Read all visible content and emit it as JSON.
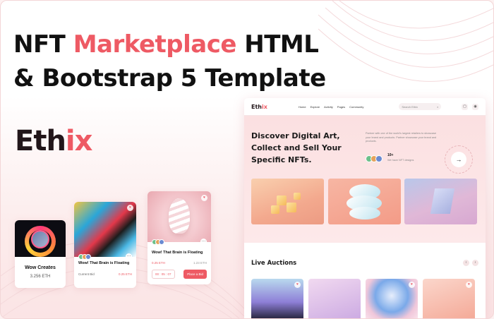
{
  "headline": {
    "line1_part1": "NFT ",
    "line1_accent": "Marketplace",
    "line1_part2": " HTML",
    "line2": "& Bootstrap 5 Template"
  },
  "brand": {
    "logo_main": "Eth",
    "logo_accent": "ix"
  },
  "cards": [
    {
      "title": "Wow Creates",
      "price": "3.256 ETH"
    },
    {
      "title": "Wow! That Brain is Floating",
      "label": "Current Bid",
      "price": "0.25 ETH"
    },
    {
      "title": "Wow! That Brain is Floating",
      "price": "0.25 ETH",
      "meta": "1.23 ETH",
      "timer": "00 : 05 : 07",
      "action": "Place a Bid"
    }
  ],
  "preview": {
    "logo_main": "Eth",
    "logo_accent": "ix",
    "menu": [
      "Home",
      "Explore",
      "Activity",
      "Pages",
      "Community"
    ],
    "search_placeholder": "Search Ethix",
    "hero_title": "Discover Digital Art, Collect and Sell Your Specific NFTs.",
    "hero_desc": "Partner with one of the world's largest retailers to showcase your brand and products. Partner showcase your brand and products.",
    "count": "10+",
    "count_sub": "We have NFT designs",
    "live_title": "Live Auctions",
    "arrow": "→"
  },
  "colors": {
    "accent": "#ee5a64",
    "dark": "#22161a"
  }
}
